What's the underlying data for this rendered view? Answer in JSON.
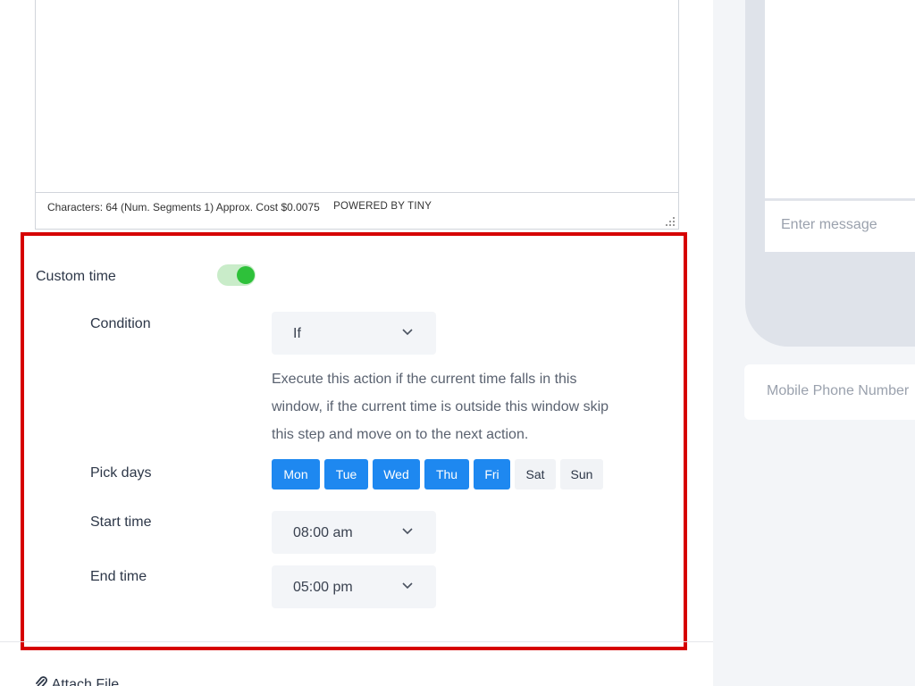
{
  "editor": {
    "status": "Characters: 64 (Num. Segments 1) Approx. Cost $0.0075",
    "powered_by": "POWERED BY TINY"
  },
  "custom_time": {
    "label": "Custom time",
    "enabled": true,
    "toggle_color": "#2ec13a"
  },
  "condition": {
    "label": "Condition",
    "value": "If",
    "description": "Execute this action if the current time falls in this window, if the current time is outside this window skip this step and move on to the next action."
  },
  "pick_days": {
    "label": "Pick days",
    "days": [
      {
        "label": "Mon",
        "selected": true
      },
      {
        "label": "Tue",
        "selected": true
      },
      {
        "label": "Wed",
        "selected": true
      },
      {
        "label": "Thu",
        "selected": true
      },
      {
        "label": "Fri",
        "selected": true
      },
      {
        "label": "Sat",
        "selected": false
      },
      {
        "label": "Sun",
        "selected": false
      }
    ],
    "selected_color": "#1e88f0"
  },
  "start_time": {
    "label": "Start time",
    "value": "08:00 am"
  },
  "end_time": {
    "label": "End time",
    "value": "05:00 pm"
  },
  "attach": {
    "label": "Attach File",
    "icon": "paperclip-icon"
  },
  "preview": {
    "message_placeholder": "Enter message",
    "mobile_placeholder": "Mobile Phone Number"
  },
  "highlight_color": "#d60000"
}
